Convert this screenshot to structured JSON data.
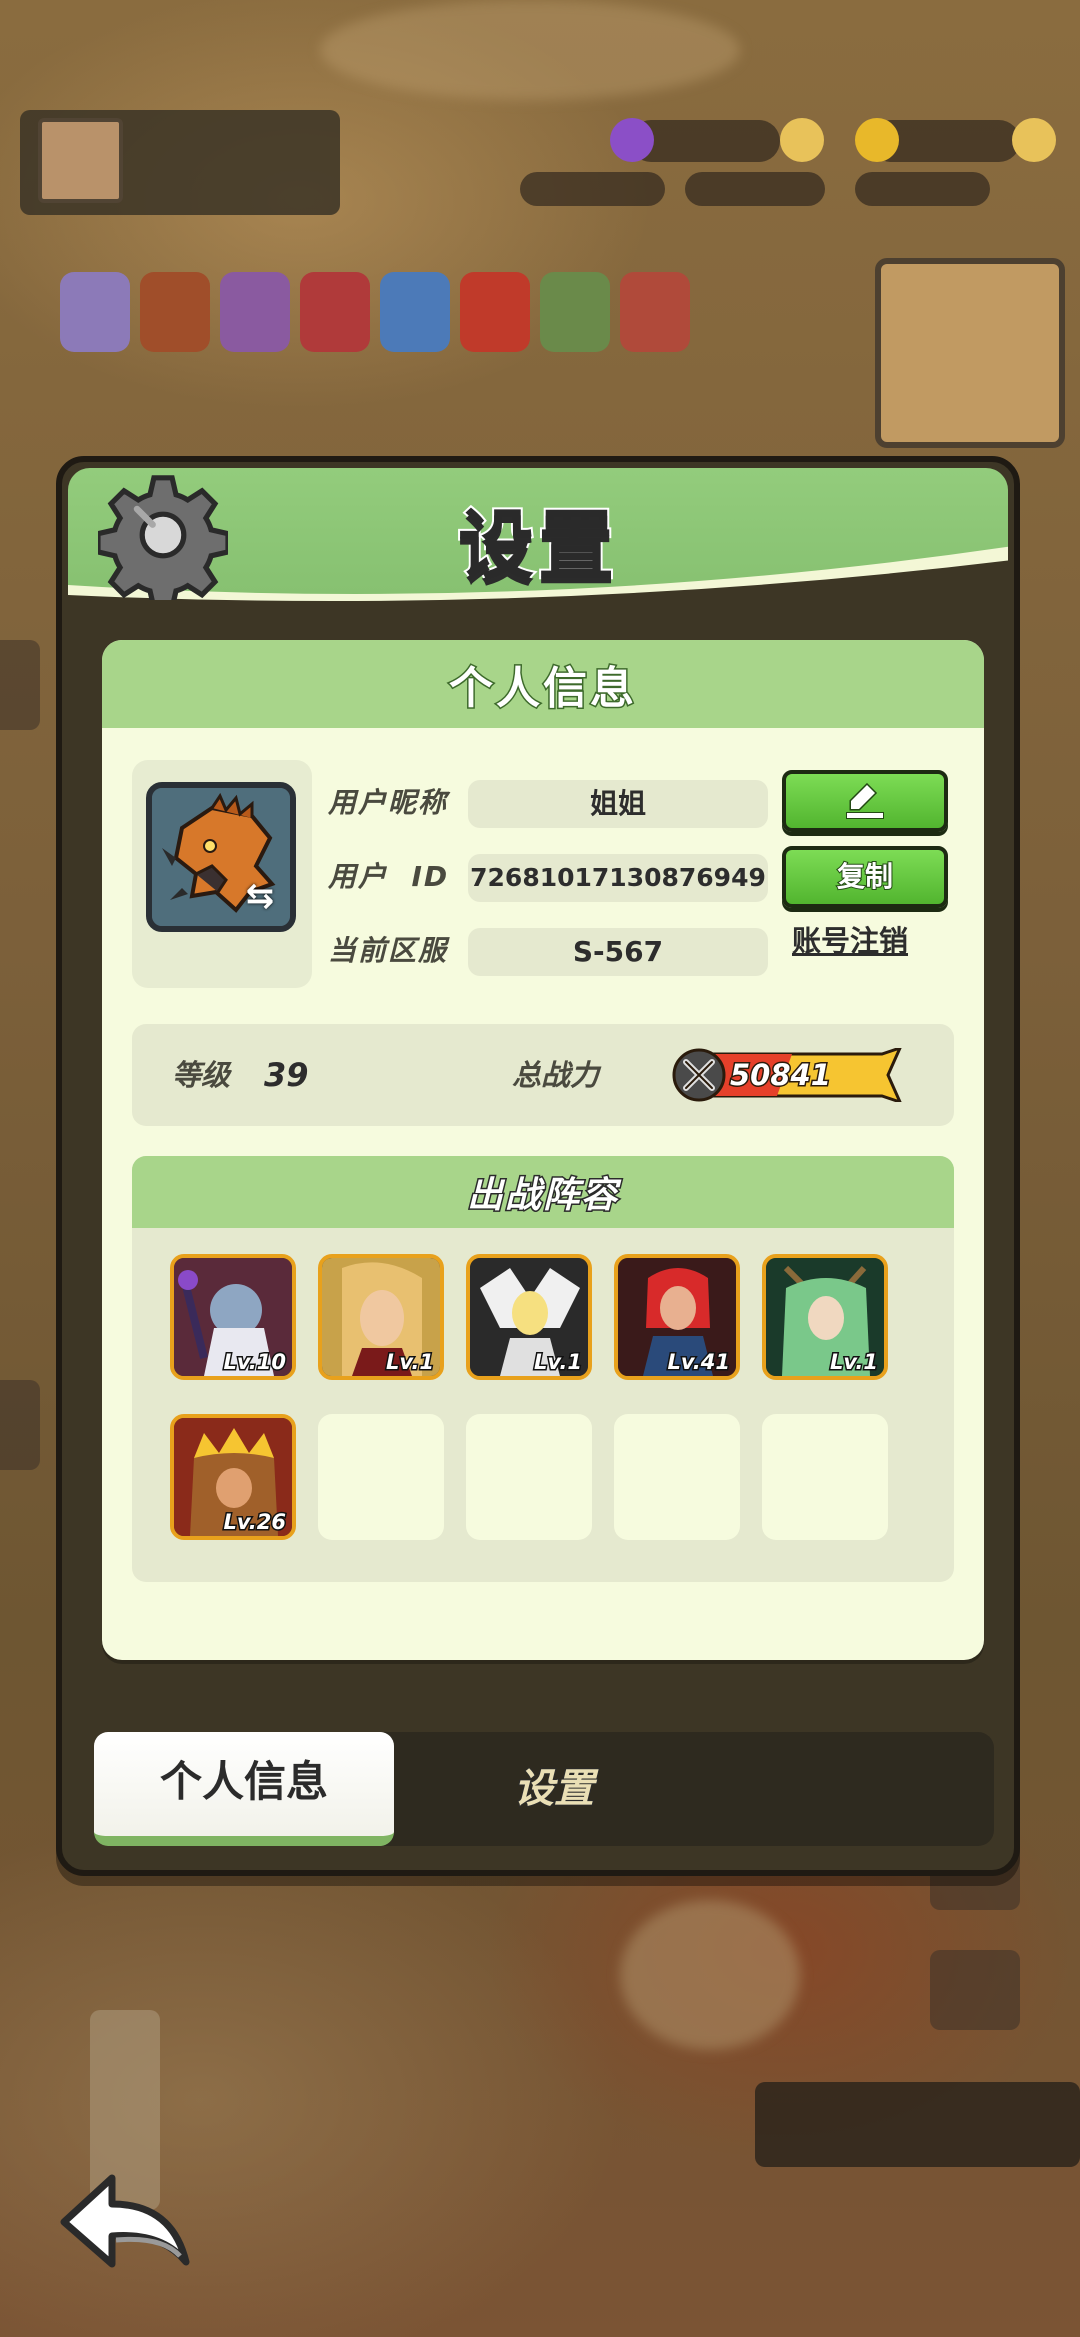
{
  "dialog": {
    "title": "设置",
    "icon": "gear-icon"
  },
  "personal_info": {
    "section_title": "个人信息",
    "nickname_label": "用户昵称",
    "nickname_value": "姐姐",
    "user_id_label": "用户  ID",
    "user_id_value": "72681017130876949",
    "server_label": "当前区服",
    "server_value": "S-567",
    "edit_icon": "pencil-icon",
    "copy_button": "复制",
    "logout_link": "账号注销"
  },
  "stats": {
    "level_label": "等级",
    "level_value": "39",
    "power_label": "总战力",
    "power_value": "50841",
    "power_icon": "crossed-swords-icon"
  },
  "lineup": {
    "title": "出战阵容",
    "heroes": [
      {
        "level": "Lv.10"
      },
      {
        "level": "Lv.1"
      },
      {
        "level": "Lv.1"
      },
      {
        "level": "Lv.41"
      },
      {
        "level": "Lv.1"
      },
      {
        "level": "Lv.26"
      }
    ],
    "empty_slots": 4
  },
  "tabs": [
    {
      "label": "个人信息",
      "active": true
    },
    {
      "label": "设置",
      "active": false
    }
  ],
  "colors": {
    "header_green": "#93cc7c",
    "panel_bg": "#f6fbde",
    "button_green": "#52b52f",
    "hero_frame": "#e8a11c"
  },
  "back_button_icon": "back-arrow-icon"
}
